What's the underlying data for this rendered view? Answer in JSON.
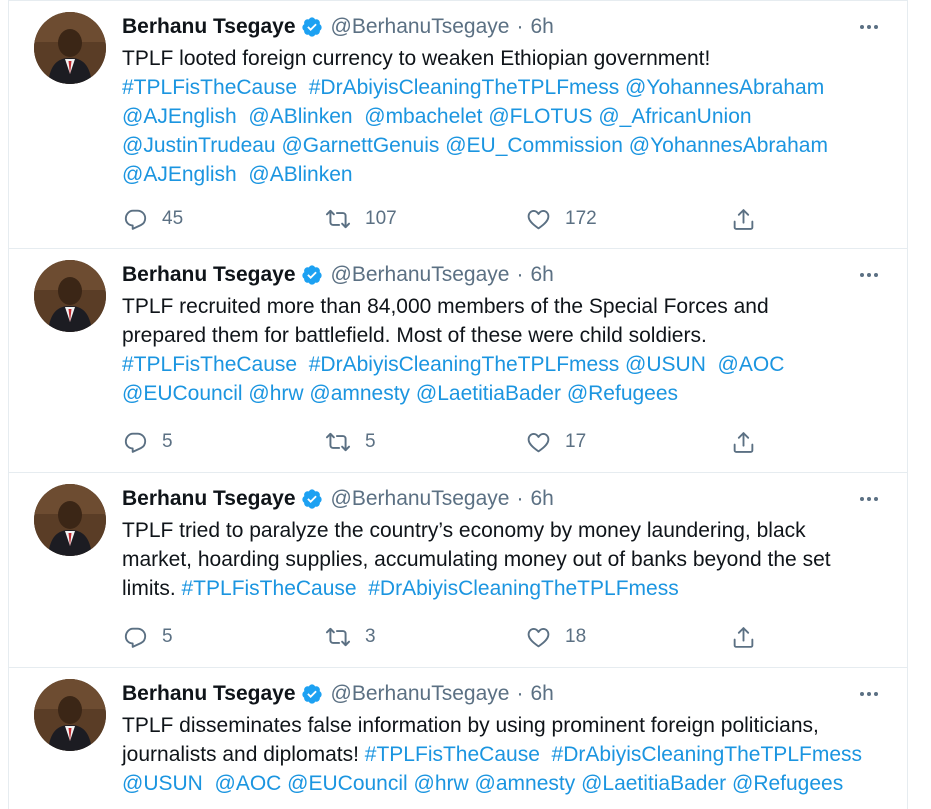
{
  "colors": {
    "link": "#1b95e0",
    "muted": "#5b7083",
    "verified": "#1da1f2",
    "divider": "#e6ecf0"
  },
  "tweets": [
    {
      "author": {
        "name": "Berhanu Tsegaye",
        "handle": "@BerhanuTsegaye",
        "verified": true,
        "avatar_icon": "profile-photo"
      },
      "separator": "·",
      "time": "6h",
      "body": [
        {
          "t": "TPLF looted foreign currency to weaken Ethiopian government!\n",
          "link": false
        },
        {
          "t": "#TPLFisTheCause",
          "link": true
        },
        {
          "t": "  ",
          "link": false
        },
        {
          "t": "#DrAbiyisCleaningTheTPLFmess",
          "link": true
        },
        {
          "t": " ",
          "link": false
        },
        {
          "t": "@YohannesAbraham",
          "link": true
        },
        {
          "t": "\n",
          "link": false
        },
        {
          "t": "@AJEnglish",
          "link": true
        },
        {
          "t": "  ",
          "link": false
        },
        {
          "t": "@ABlinken",
          "link": true
        },
        {
          "t": "  ",
          "link": false
        },
        {
          "t": "@mbachelet",
          "link": true
        },
        {
          "t": " ",
          "link": false
        },
        {
          "t": "@FLOTUS",
          "link": true
        },
        {
          "t": " ",
          "link": false
        },
        {
          "t": "@_AfricanUnion",
          "link": true
        },
        {
          "t": "\n",
          "link": false
        },
        {
          "t": "@JustinTrudeau",
          "link": true
        },
        {
          "t": " ",
          "link": false
        },
        {
          "t": "@GarnettGenuis",
          "link": true
        },
        {
          "t": " ",
          "link": false
        },
        {
          "t": "@EU_Commission",
          "link": true
        },
        {
          "t": " ",
          "link": false
        },
        {
          "t": "@YohannesAbraham",
          "link": true
        },
        {
          "t": "\n",
          "link": false
        },
        {
          "t": "@AJEnglish",
          "link": true
        },
        {
          "t": "  ",
          "link": false
        },
        {
          "t": "@ABlinken",
          "link": true
        }
      ],
      "replies": "45",
      "retweets": "107",
      "likes": "172"
    },
    {
      "author": {
        "name": "Berhanu Tsegaye",
        "handle": "@BerhanuTsegaye",
        "verified": true,
        "avatar_icon": "profile-photo"
      },
      "separator": "·",
      "time": "6h",
      "body": [
        {
          "t": "TPLF recruited more than 84,000 members of the Special Forces and\nprepared them for battlefield. Most of these were child soldiers.\n",
          "link": false
        },
        {
          "t": "#TPLFisTheCause",
          "link": true
        },
        {
          "t": "  ",
          "link": false
        },
        {
          "t": "#DrAbiyisCleaningTheTPLFmess",
          "link": true
        },
        {
          "t": " ",
          "link": false
        },
        {
          "t": "@USUN",
          "link": true
        },
        {
          "t": "  ",
          "link": false
        },
        {
          "t": "@AOC",
          "link": true
        },
        {
          "t": "\n",
          "link": false
        },
        {
          "t": "@EUCouncil",
          "link": true
        },
        {
          "t": " ",
          "link": false
        },
        {
          "t": "@hrw",
          "link": true
        },
        {
          "t": " ",
          "link": false
        },
        {
          "t": "@amnesty",
          "link": true
        },
        {
          "t": " ",
          "link": false
        },
        {
          "t": "@LaetitiaBader",
          "link": true
        },
        {
          "t": " ",
          "link": false
        },
        {
          "t": "@Refugees",
          "link": true
        }
      ],
      "replies": "5",
      "retweets": "5",
      "likes": "17"
    },
    {
      "author": {
        "name": "Berhanu Tsegaye",
        "handle": "@BerhanuTsegaye",
        "verified": true,
        "avatar_icon": "profile-photo"
      },
      "separator": "·",
      "time": "6h",
      "body": [
        {
          "t": "TPLF tried to paralyze the country’s economy by money laundering, black\nmarket, hoarding supplies, accumulating money out of banks beyond the set\nlimits. ",
          "link": false
        },
        {
          "t": "#TPLFisTheCause",
          "link": true
        },
        {
          "t": "  ",
          "link": false
        },
        {
          "t": "#DrAbiyisCleaningTheTPLFmess",
          "link": true
        }
      ],
      "replies": "5",
      "retweets": "3",
      "likes": "18"
    },
    {
      "author": {
        "name": "Berhanu Tsegaye",
        "handle": "@BerhanuTsegaye",
        "verified": true,
        "avatar_icon": "profile-photo"
      },
      "separator": "·",
      "time": "6h",
      "body": [
        {
          "t": "TPLF disseminates false information by using prominent foreign politicians,\njournalists and diplomats! ",
          "link": false
        },
        {
          "t": "#TPLFisTheCause",
          "link": true
        },
        {
          "t": "  ",
          "link": false
        },
        {
          "t": "#DrAbiyisCleaningTheTPLFmess",
          "link": true
        },
        {
          "t": "\n",
          "link": false
        },
        {
          "t": "@USUN",
          "link": true
        },
        {
          "t": "  ",
          "link": false
        },
        {
          "t": "@AOC",
          "link": true
        },
        {
          "t": " ",
          "link": false
        },
        {
          "t": "@EUCouncil",
          "link": true
        },
        {
          "t": " ",
          "link": false
        },
        {
          "t": "@hrw",
          "link": true
        },
        {
          "t": " ",
          "link": false
        },
        {
          "t": "@amnesty",
          "link": true
        },
        {
          "t": " ",
          "link": false
        },
        {
          "t": "@LaetitiaBader",
          "link": true
        },
        {
          "t": " ",
          "link": false
        },
        {
          "t": "@Refugees",
          "link": true
        }
      ],
      "replies": null,
      "retweets": null,
      "likes": null
    }
  ]
}
